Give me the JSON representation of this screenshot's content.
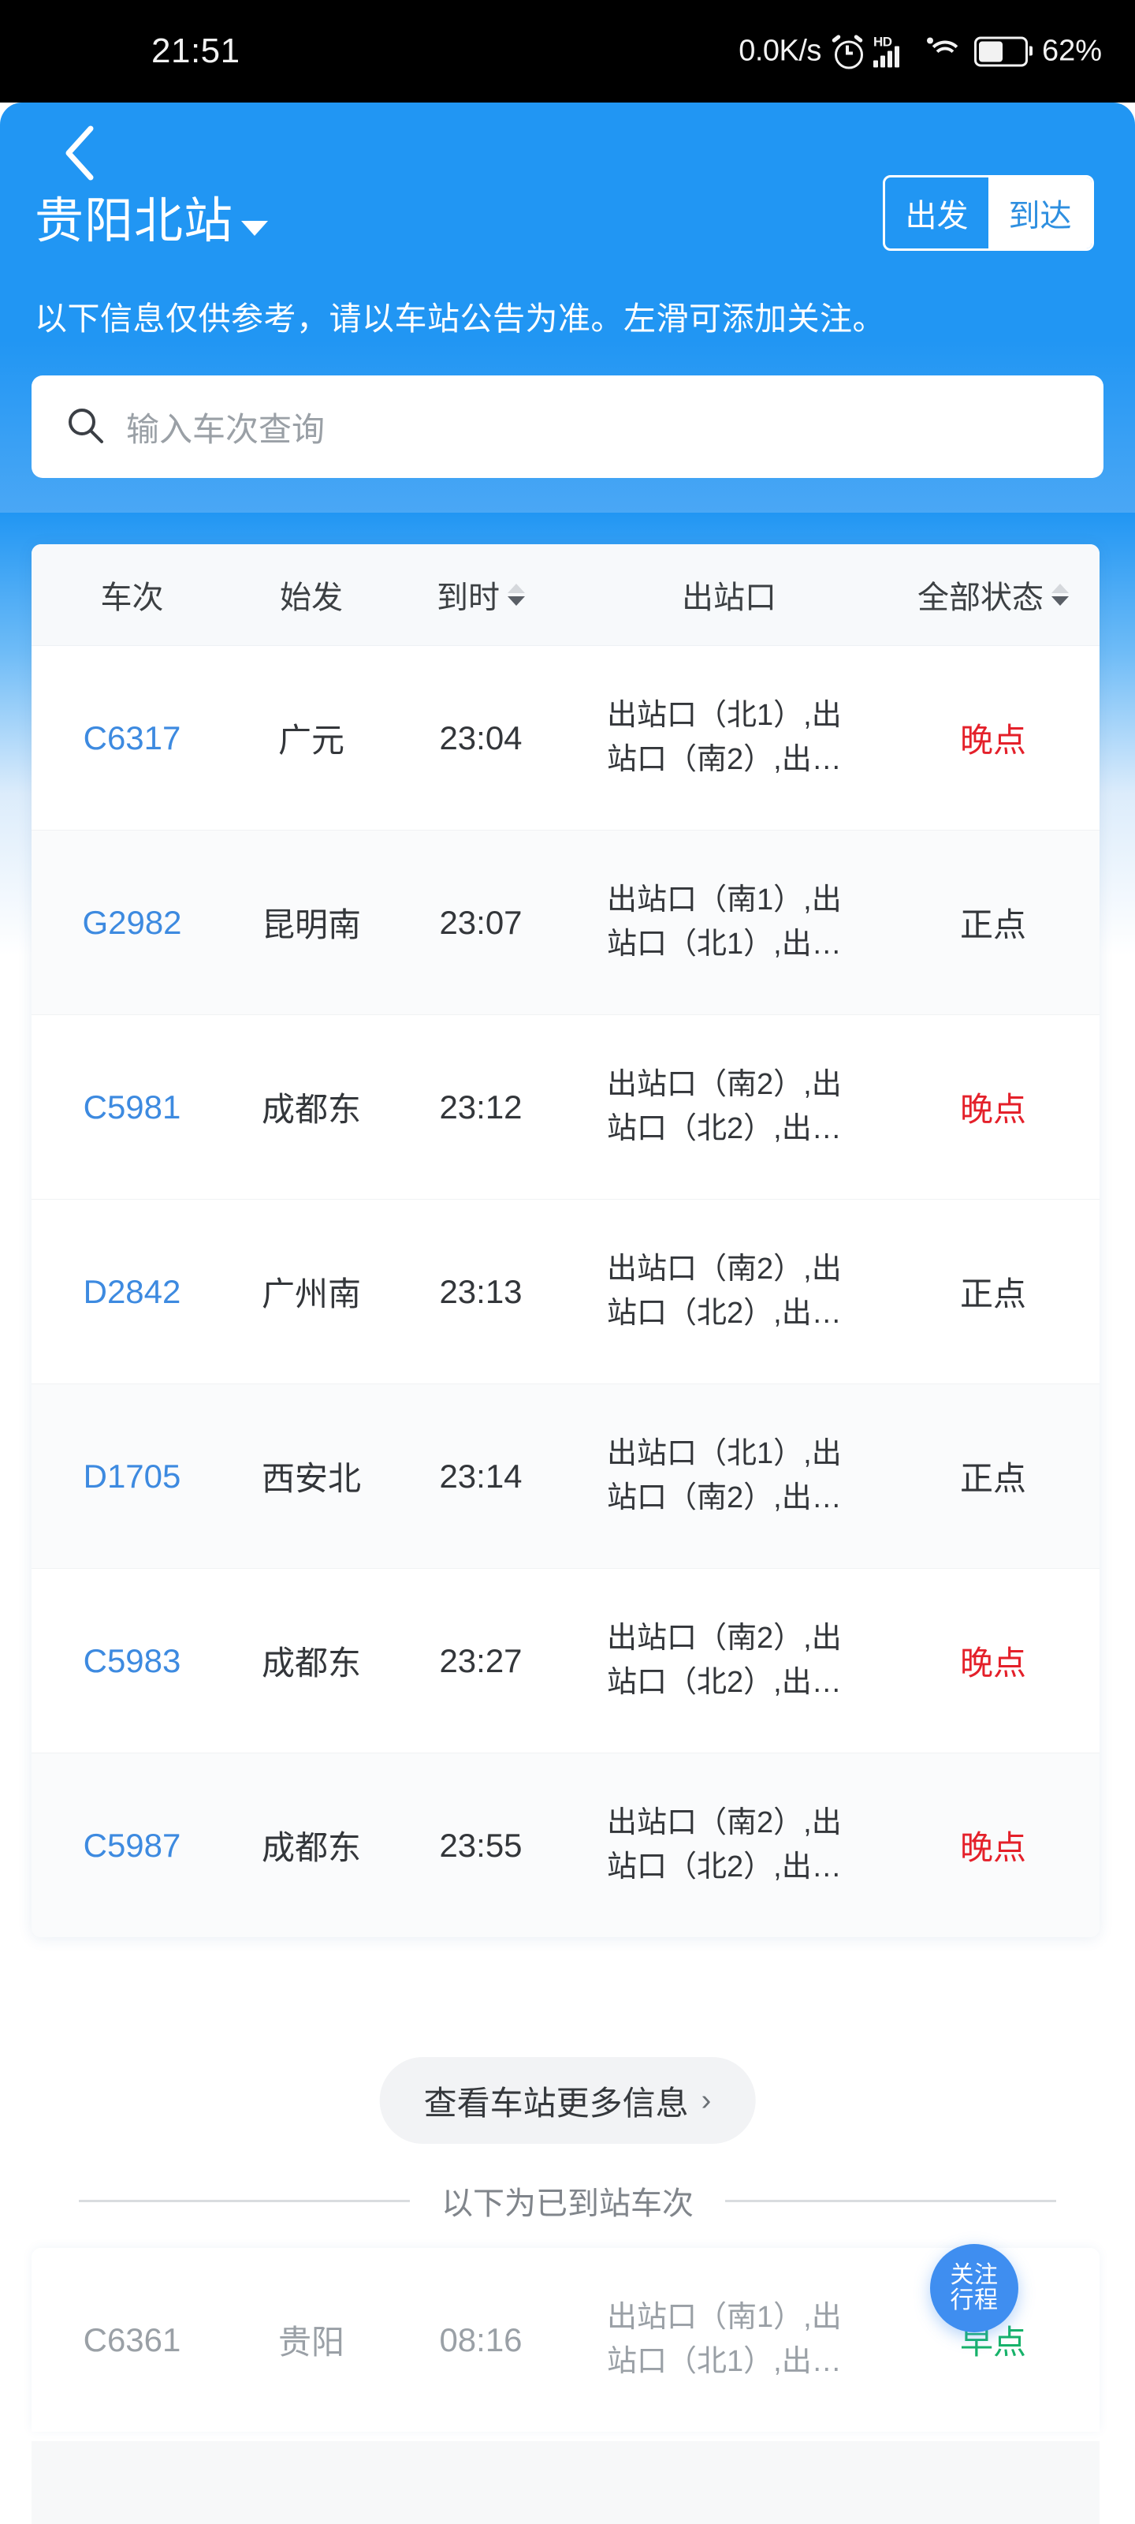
{
  "statusbar": {
    "time": "21:51",
    "network_speed": "0.0K/s",
    "hd_label": "HD",
    "battery_percent": "62%",
    "icons": [
      "alarm-icon",
      "hd-icon",
      "signal-icon",
      "wifi-icon",
      "battery-icon"
    ]
  },
  "header": {
    "back_icon": "back-chevron-icon",
    "station_title": "贵阳北站",
    "dropdown_icon": "caret-down-icon",
    "segment": {
      "departure_label": "出发",
      "arrival_label": "到达",
      "selected": "到达"
    },
    "notice": "以下信息仅供参考，请以车站公告为准。左滑可添加关注。",
    "accent_color": "#2196f3"
  },
  "search": {
    "icon": "search-icon",
    "placeholder": "输入车次查询",
    "value": ""
  },
  "table": {
    "columns": [
      {
        "label": "车次",
        "sortable": false
      },
      {
        "label": "始发",
        "sortable": false
      },
      {
        "label": "到时",
        "sortable": true
      },
      {
        "label": "出站口",
        "sortable": false
      },
      {
        "label": "全部状态",
        "sortable": true
      }
    ],
    "rows": [
      {
        "train": "C6317",
        "origin": "广元",
        "time": "23:04",
        "gate": "出站口（北1）,出站口（南2）,出…",
        "status": "晚点",
        "status_kind": "late"
      },
      {
        "train": "G2982",
        "origin": "昆明南",
        "time": "23:07",
        "gate": "出站口（南1）,出站口（北1）,出…",
        "status": "正点",
        "status_kind": "ontime"
      },
      {
        "train": "C5981",
        "origin": "成都东",
        "time": "23:12",
        "gate": "出站口（南2）,出站口（北2）,出…",
        "status": "晚点",
        "status_kind": "late"
      },
      {
        "train": "D2842",
        "origin": "广州南",
        "time": "23:13",
        "gate": "出站口（南2）,出站口（北2）,出…",
        "status": "正点",
        "status_kind": "ontime"
      },
      {
        "train": "D1705",
        "origin": "西安北",
        "time": "23:14",
        "gate": "出站口（北1）,出站口（南2）,出…",
        "status": "正点",
        "status_kind": "ontime"
      },
      {
        "train": "C5983",
        "origin": "成都东",
        "time": "23:27",
        "gate": "出站口（南2）,出站口（北2）,出…",
        "status": "晚点",
        "status_kind": "late"
      },
      {
        "train": "C5987",
        "origin": "成都东",
        "time": "23:55",
        "gate": "出站口（南2）,出站口（北2）,出…",
        "status": "晚点",
        "status_kind": "late"
      }
    ]
  },
  "more_info": {
    "label": "查看车站更多信息",
    "chevron_icon": "chevron-right-icon"
  },
  "arrived_section": {
    "divider_label": "以下为已到站车次",
    "rows": [
      {
        "train": "C6361",
        "origin": "贵阳",
        "time": "08:16",
        "gate": "出站口（南1）,出站口（北1）,出…",
        "status": "早点",
        "status_kind": "early"
      }
    ]
  },
  "fab": {
    "line1": "关注",
    "line2": "行程",
    "color": "#3f8ef0"
  },
  "status_colors": {
    "late": "#e4202a",
    "ontime": "#33363a",
    "early": "#17b26a",
    "train_no": "#3d8ae0"
  }
}
